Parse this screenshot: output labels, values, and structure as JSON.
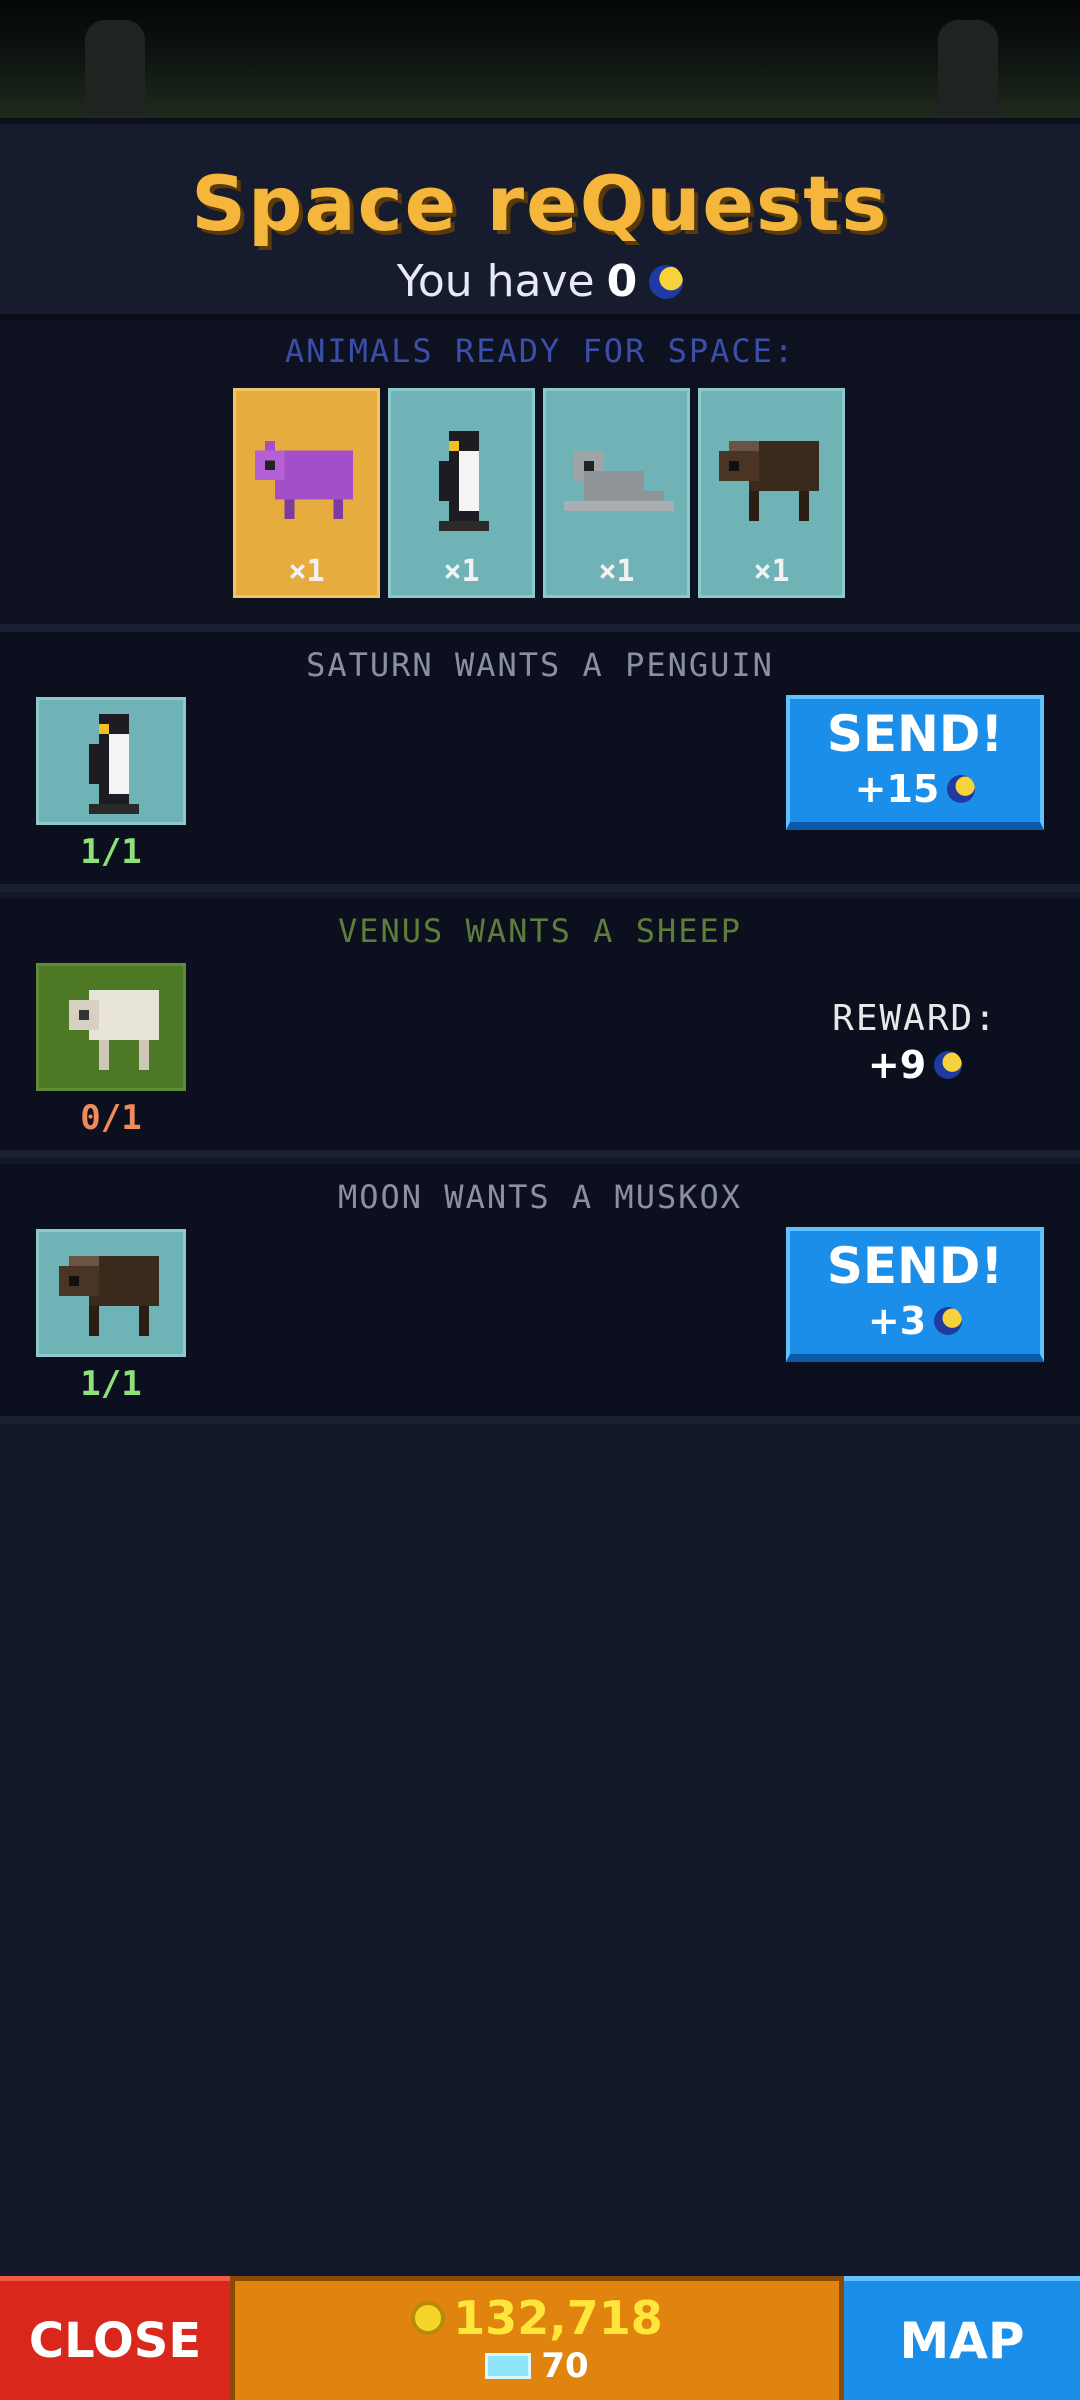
{
  "header": {
    "title": "Space reQuests",
    "you_have_prefix": "You have",
    "you_have_amount": "0",
    "currency_icon": "space-token-icon"
  },
  "ready": {
    "title": "ANIMALS READY FOR SPACE:",
    "animals": [
      {
        "name": "hippo",
        "count": "×1",
        "selected": true
      },
      {
        "name": "penguin",
        "count": "×1",
        "selected": false
      },
      {
        "name": "seal",
        "count": "×1",
        "selected": false
      },
      {
        "name": "muskox",
        "count": "×1",
        "selected": false
      }
    ]
  },
  "quests": [
    {
      "title": "SATURN WANTS A PENGUIN",
      "animal": "penguin",
      "progress": "1/1",
      "action": "SEND!",
      "reward": "+15"
    },
    {
      "title": "VENUS WANTS A SHEEP",
      "animal": "sheep",
      "progress": "0/1",
      "reward_label": "REWARD:",
      "reward": "+9"
    },
    {
      "title": "MOON WANTS A MUSKOX",
      "animal": "muskox",
      "progress": "1/1",
      "action": "SEND!",
      "reward": "+3"
    }
  ],
  "bottom": {
    "close_label": "CLOSE",
    "coins": "132,718",
    "gems": "70",
    "map_label": "MAP"
  },
  "colors": {
    "title": "#f5b73b",
    "send_button": "#1a8ee8",
    "close_button": "#d9281b",
    "money_bar": "#e0830f"
  }
}
